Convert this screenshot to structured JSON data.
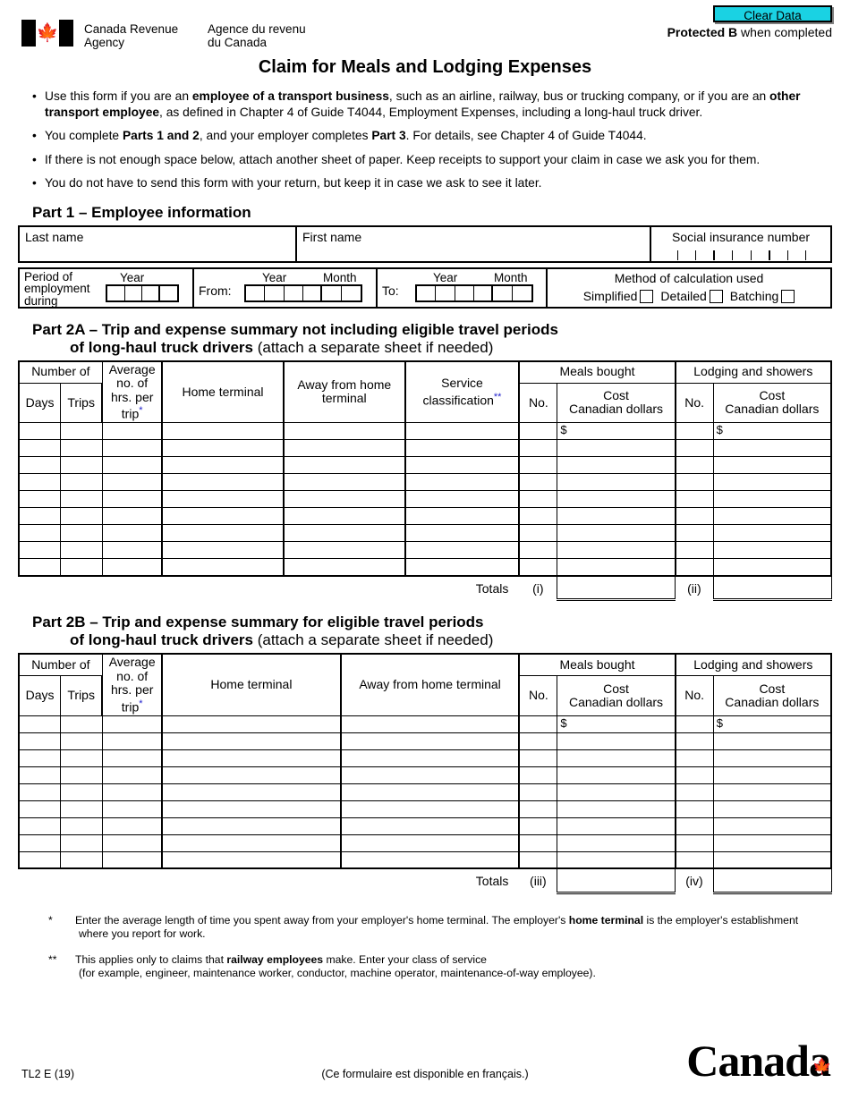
{
  "header": {
    "dept_en_line1": "Canada Revenue",
    "dept_en_line2": "Agency",
    "dept_fr_line1": "Agence du revenu",
    "dept_fr_line2": "du Canada",
    "clear_data_label": "Clear Data",
    "clear_data_color": "#1ad2e3",
    "protected_bold": "Protected B",
    "protected_rest": " when completed",
    "flag_icon": "canada-flag-icon"
  },
  "title": "Claim for Meals and Lodging Expenses",
  "bullets": [
    {
      "segments": [
        {
          "t": "Use this form if you are an ",
          "b": false
        },
        {
          "t": "employee of a transport business",
          "b": true
        },
        {
          "t": ", such as an airline, railway, bus or trucking company, or if you are an ",
          "b": false
        },
        {
          "t": "other transport employee",
          "b": true
        },
        {
          "t": ", as defined in Chapter 4 of Guide T4044, Employment Expenses, including a long-haul truck driver.",
          "b": false
        }
      ]
    },
    {
      "segments": [
        {
          "t": "You complete ",
          "b": false
        },
        {
          "t": "Parts 1 and 2",
          "b": true
        },
        {
          "t": ", and your employer completes ",
          "b": false
        },
        {
          "t": "Part 3",
          "b": true
        },
        {
          "t": ". For details, see Chapter 4 of Guide T4044.",
          "b": false
        }
      ]
    },
    {
      "segments": [
        {
          "t": "If there is not enough space below, attach another sheet of paper. Keep receipts to support your claim in case we ask you for them.",
          "b": false
        }
      ]
    },
    {
      "segments": [
        {
          "t": "You do not have to send this form with your return, but keep it in case we ask to see it later.",
          "b": false
        }
      ]
    }
  ],
  "part1": {
    "heading": "Part 1 – Employee information",
    "last_name_label": "Last name",
    "first_name_label": "First name",
    "sin_label": "Social insurance number",
    "sin_boxes": 9,
    "period_label_l1": "Period of",
    "period_label_l2": "employment",
    "period_label_l3": "during",
    "year_label": "Year",
    "month_label": "Month",
    "from_label": "From:",
    "to_label": "To:",
    "period_year_boxes": 4,
    "from_boxes": 6,
    "to_boxes": 6,
    "method_title": "Method of calculation used",
    "method_options": [
      "Simplified",
      "Detailed",
      "Batching"
    ]
  },
  "part2a": {
    "heading_l1_bold": "Part 2A – Trip and expense summary not including eligible travel periods",
    "heading_l2_bold": "of long-haul truck drivers",
    "heading_l2_light": " (attach a separate sheet if needed)",
    "headers": {
      "number_of": "Number of",
      "days": "Days",
      "trips": "Trips",
      "avg_l1": "Average",
      "avg_l2": "no. of",
      "avg_l3": "hrs. per",
      "avg_l4": "trip",
      "avg_asterisk": "*",
      "home_terminal": "Home terminal",
      "away_l1": "Away from home",
      "away_l2": "terminal",
      "service_l1": "Service",
      "service_l2": "classification",
      "service_asterisk": "**",
      "meals_bought": "Meals bought",
      "lodging": "Lodging and showers",
      "no": "No.",
      "cost_l1": "Cost",
      "cost_l2": "Canadian dollars"
    },
    "rows": 9,
    "dollar_sign": "$",
    "totals_label": "Totals",
    "total_ref_meals": "(i)",
    "total_ref_lodging": "(ii)"
  },
  "part2b": {
    "heading_l1_bold": "Part 2B – Trip and expense summary for eligible travel periods",
    "heading_l2_bold": "of long-haul truck drivers",
    "heading_l2_light": " (attach a separate sheet if needed)",
    "headers": {
      "number_of": "Number of",
      "days": "Days",
      "trips": "Trips",
      "avg_l1": "Average",
      "avg_l2": "no. of",
      "avg_l3": "hrs. per",
      "avg_l4": "trip",
      "avg_asterisk": "*",
      "home_terminal": "Home terminal",
      "away": "Away from home terminal",
      "meals_bought": "Meals bought",
      "lodging": "Lodging and showers",
      "no": "No.",
      "cost_l1": "Cost",
      "cost_l2": "Canadian dollars"
    },
    "rows": 9,
    "dollar_sign": "$",
    "totals_label": "Totals",
    "total_ref_meals": "(iii)",
    "total_ref_lodging": "(iv)"
  },
  "notes": [
    {
      "marker": "*",
      "segments": [
        {
          "t": "Enter the average length of time you spent away from your employer's home terminal. The employer's ",
          "b": false
        },
        {
          "t": "home terminal",
          "b": true
        },
        {
          "t": " is the employer's establishment",
          "b": false
        }
      ],
      "line2": "where you report for work."
    },
    {
      "marker": "**",
      "segments": [
        {
          "t": "This applies only to claims that ",
          "b": false
        },
        {
          "t": "railway employees",
          "b": true
        },
        {
          "t": " make. Enter your class of service",
          "b": false
        }
      ],
      "line2": "(for example, engineer, maintenance worker, conductor, machine operator, maintenance-of-way employee)."
    }
  ],
  "footer": {
    "form_id": "TL2 E (19)",
    "french_note": "(Ce formulaire est disponible en français.)",
    "wordmark": "Canada"
  }
}
